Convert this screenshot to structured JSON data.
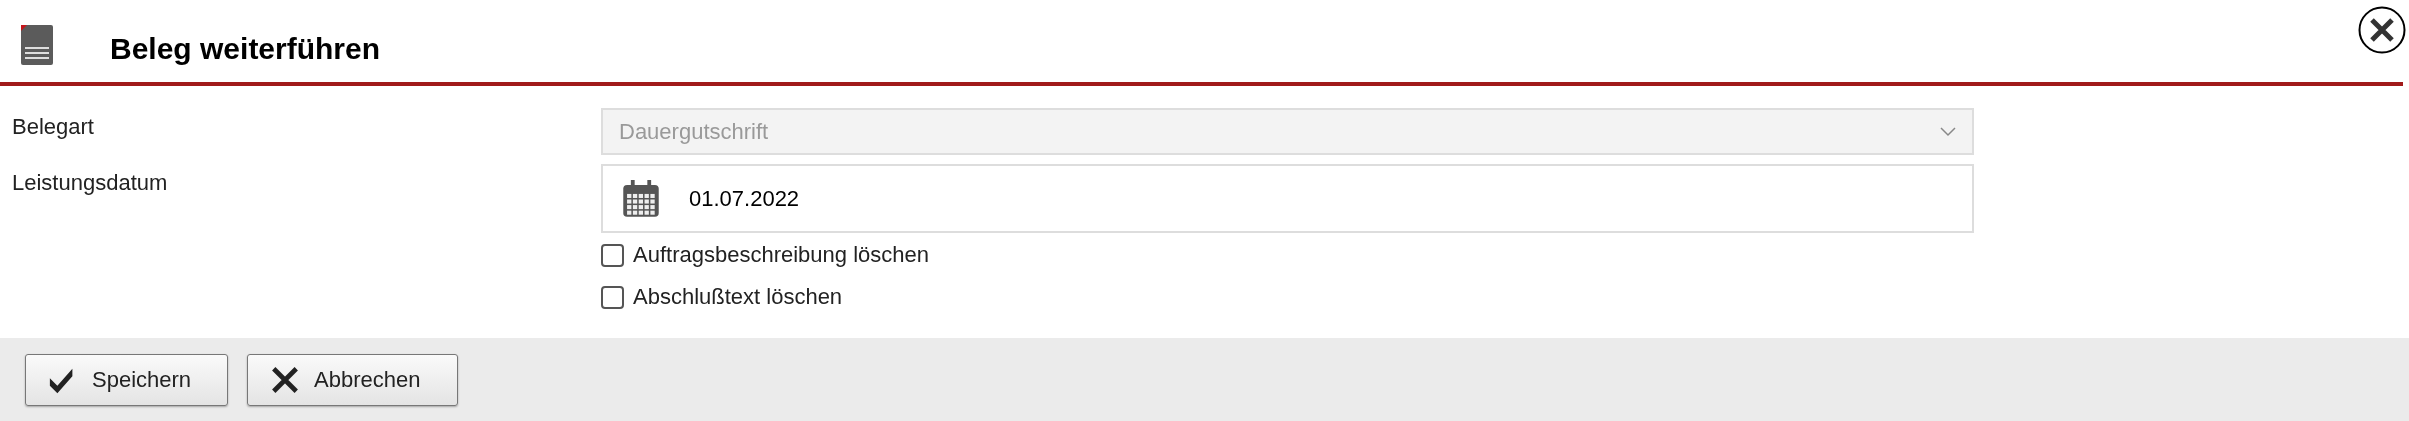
{
  "dialog": {
    "title": "Beleg weiterführen"
  },
  "fields": [
    {
      "kind": "select",
      "label": "Belegart",
      "value": "Dauergutschrift",
      "disabled": true
    },
    {
      "kind": "date",
      "label": "Leistungsdatum",
      "value": "01.07.2022"
    }
  ],
  "options": [
    {
      "label": "Auftragsbeschreibung löschen",
      "checked": false
    },
    {
      "label": "Abschlußtext löschen",
      "checked": false
    }
  ],
  "buttons": [
    {
      "kind": "save",
      "label": "Speichern"
    },
    {
      "kind": "cancel",
      "label": "Abbrechen"
    }
  ]
}
